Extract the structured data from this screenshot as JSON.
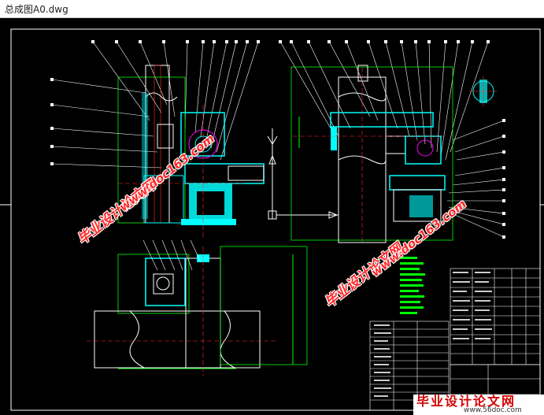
{
  "window": {
    "title": "总成图A0.dwg"
  },
  "watermark": {
    "site_name": "毕业设计论文网",
    "url": "www.doc163.com",
    "brand_name": "毕业设计论文网",
    "brand_url": "www.56doc.com"
  },
  "colors": {
    "background": "#000000",
    "line_white": "#ffffff",
    "line_green": "#00ff00",
    "line_cyan": "#00ffff",
    "line_red": "#ff3030",
    "line_magenta": "#ff00ff",
    "line_yellow": "#ffff00",
    "watermark_red": "#ff2a2a"
  }
}
